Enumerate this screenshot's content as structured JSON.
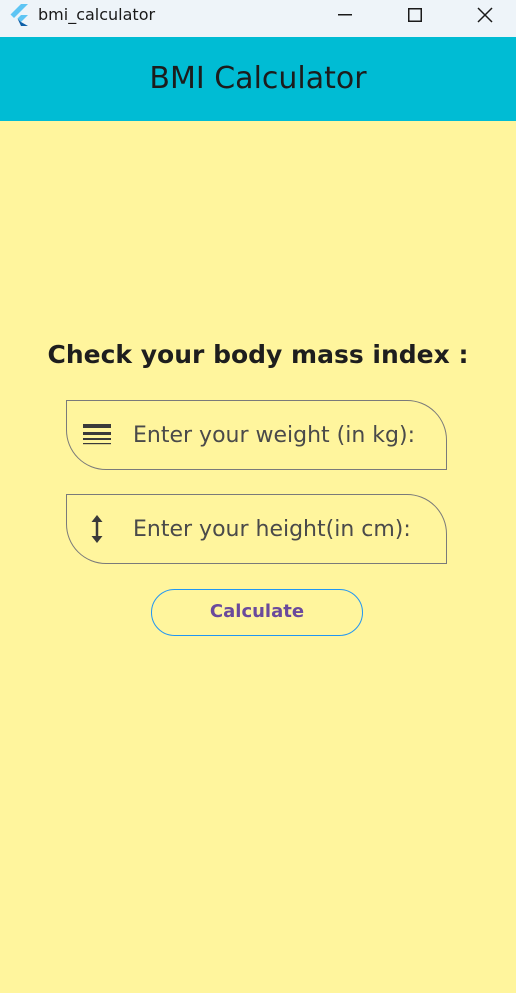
{
  "window": {
    "title": "bmi_calculator",
    "app_icon": "flutter-logo-icon",
    "controls": [
      "minimize-icon",
      "maximize-icon",
      "close-icon"
    ]
  },
  "appbar": {
    "title": "BMI Calculator",
    "color": "#00bcd4"
  },
  "main": {
    "background": "#fff59d",
    "heading": "Check your body mass index :",
    "weight_field": {
      "icon": "line-weight-icon",
      "placeholder": "Enter your weight (in kg):",
      "value": ""
    },
    "height_field": {
      "icon": "height-arrow-icon",
      "placeholder": "Enter your height(in cm):",
      "value": ""
    },
    "calculate_button": {
      "label": "Calculate",
      "border_color": "#2196f3",
      "text_color": "#6a4a9c"
    }
  }
}
